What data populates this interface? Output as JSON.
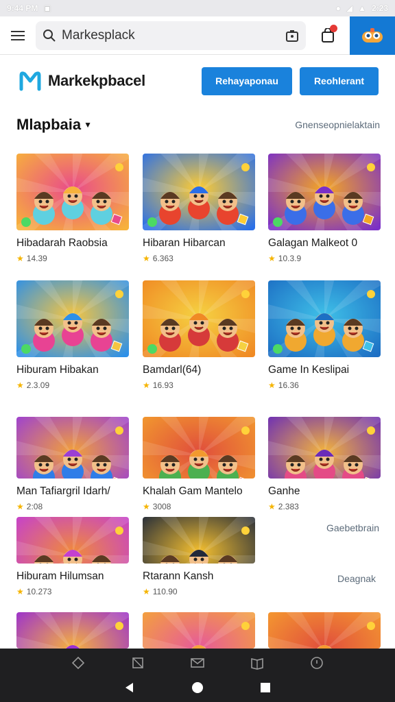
{
  "status_bar": {
    "time": "9:44 PM",
    "right_text": "2:23"
  },
  "search": {
    "placeholder": "Markesplack",
    "value": "Markesplack"
  },
  "header": {
    "brand": "Markekpbacel",
    "button_1": "Rehayaponau",
    "button_2": "Reohlerant"
  },
  "section": {
    "title": "Mlapbaia",
    "link": "Gnenseopnielaktain"
  },
  "cards": [
    {
      "title": "Hibadarah Raobsia",
      "rating": "14.39",
      "art": "HIB",
      "colors": [
        "#f7b23b",
        "#e94b8a",
        "#5fd0e0"
      ]
    },
    {
      "title": "Hibaran Hibarcan",
      "rating": "6.363",
      "art": "HIRNO",
      "colors": [
        "#2a6fe8",
        "#ffcc33",
        "#e8442e"
      ]
    },
    {
      "title": "Galagan Malkeot 0",
      "rating": "10.3.9",
      "art": "GAL",
      "colors": [
        "#7a2fc8",
        "#f5a623",
        "#3b6ee8"
      ]
    },
    {
      "title": "Hiburam Hibakan",
      "rating": "2.3.09",
      "art": "DISEEHO",
      "colors": [
        "#2d90e8",
        "#f5c542",
        "#e84393"
      ]
    },
    {
      "title": "Bamdarl(64)",
      "rating": "16.93",
      "art": "ROBIRN",
      "colors": [
        "#f08a24",
        "#f5d142",
        "#d63a3a"
      ]
    },
    {
      "title": "Game In Keslipai",
      "rating": "16.36",
      "art": "GAME",
      "colors": [
        "#1d6fc4",
        "#3fc0e8",
        "#f0a830"
      ]
    },
    {
      "title": "Man Tafiargril Idarh/",
      "rating": "2:08",
      "art": "MHURAS",
      "colors": [
        "#9b3fd4",
        "#f2a03a",
        "#2f7de8"
      ]
    },
    {
      "title": "Khalah Gam Mantelo",
      "rating": "3008",
      "art": "MASIBN",
      "colors": [
        "#f29a2e",
        "#e04e3c",
        "#4cb050"
      ]
    },
    {
      "title": "Ganhe",
      "rating": "2.383",
      "art": "BBAKA",
      "colors": [
        "#6a2cb8",
        "#f3b33d",
        "#e44b86"
      ]
    },
    {
      "title": "Hiburam Hilumsan",
      "rating": "10.273",
      "art": "HILU",
      "colors": [
        "#c43fd0",
        "#f08a3c",
        "#3a6fe0"
      ]
    },
    {
      "title": "Rtarann Kansh",
      "rating": "110.90",
      "art": "HEBIDIS",
      "colors": [
        "#222a3a",
        "#f5c030",
        "#e0573a"
      ]
    }
  ],
  "bottom_cards": [
    {
      "colors": [
        "#9a2fd0",
        "#f5b040",
        "#3a8ee8"
      ]
    },
    {
      "colors": [
        "#f4a33a",
        "#e65a9a",
        "#4fc0e8"
      ]
    },
    {
      "colors": [
        "#f59a30",
        "#e04e3c",
        "#3cb0e8"
      ]
    }
  ],
  "side_links": {
    "first": "Gaebetbrain",
    "second": "Deagnak"
  },
  "nav_icons": [
    "diamond-icon",
    "frame-icon",
    "mail-icon",
    "book-icon",
    "info-icon"
  ]
}
